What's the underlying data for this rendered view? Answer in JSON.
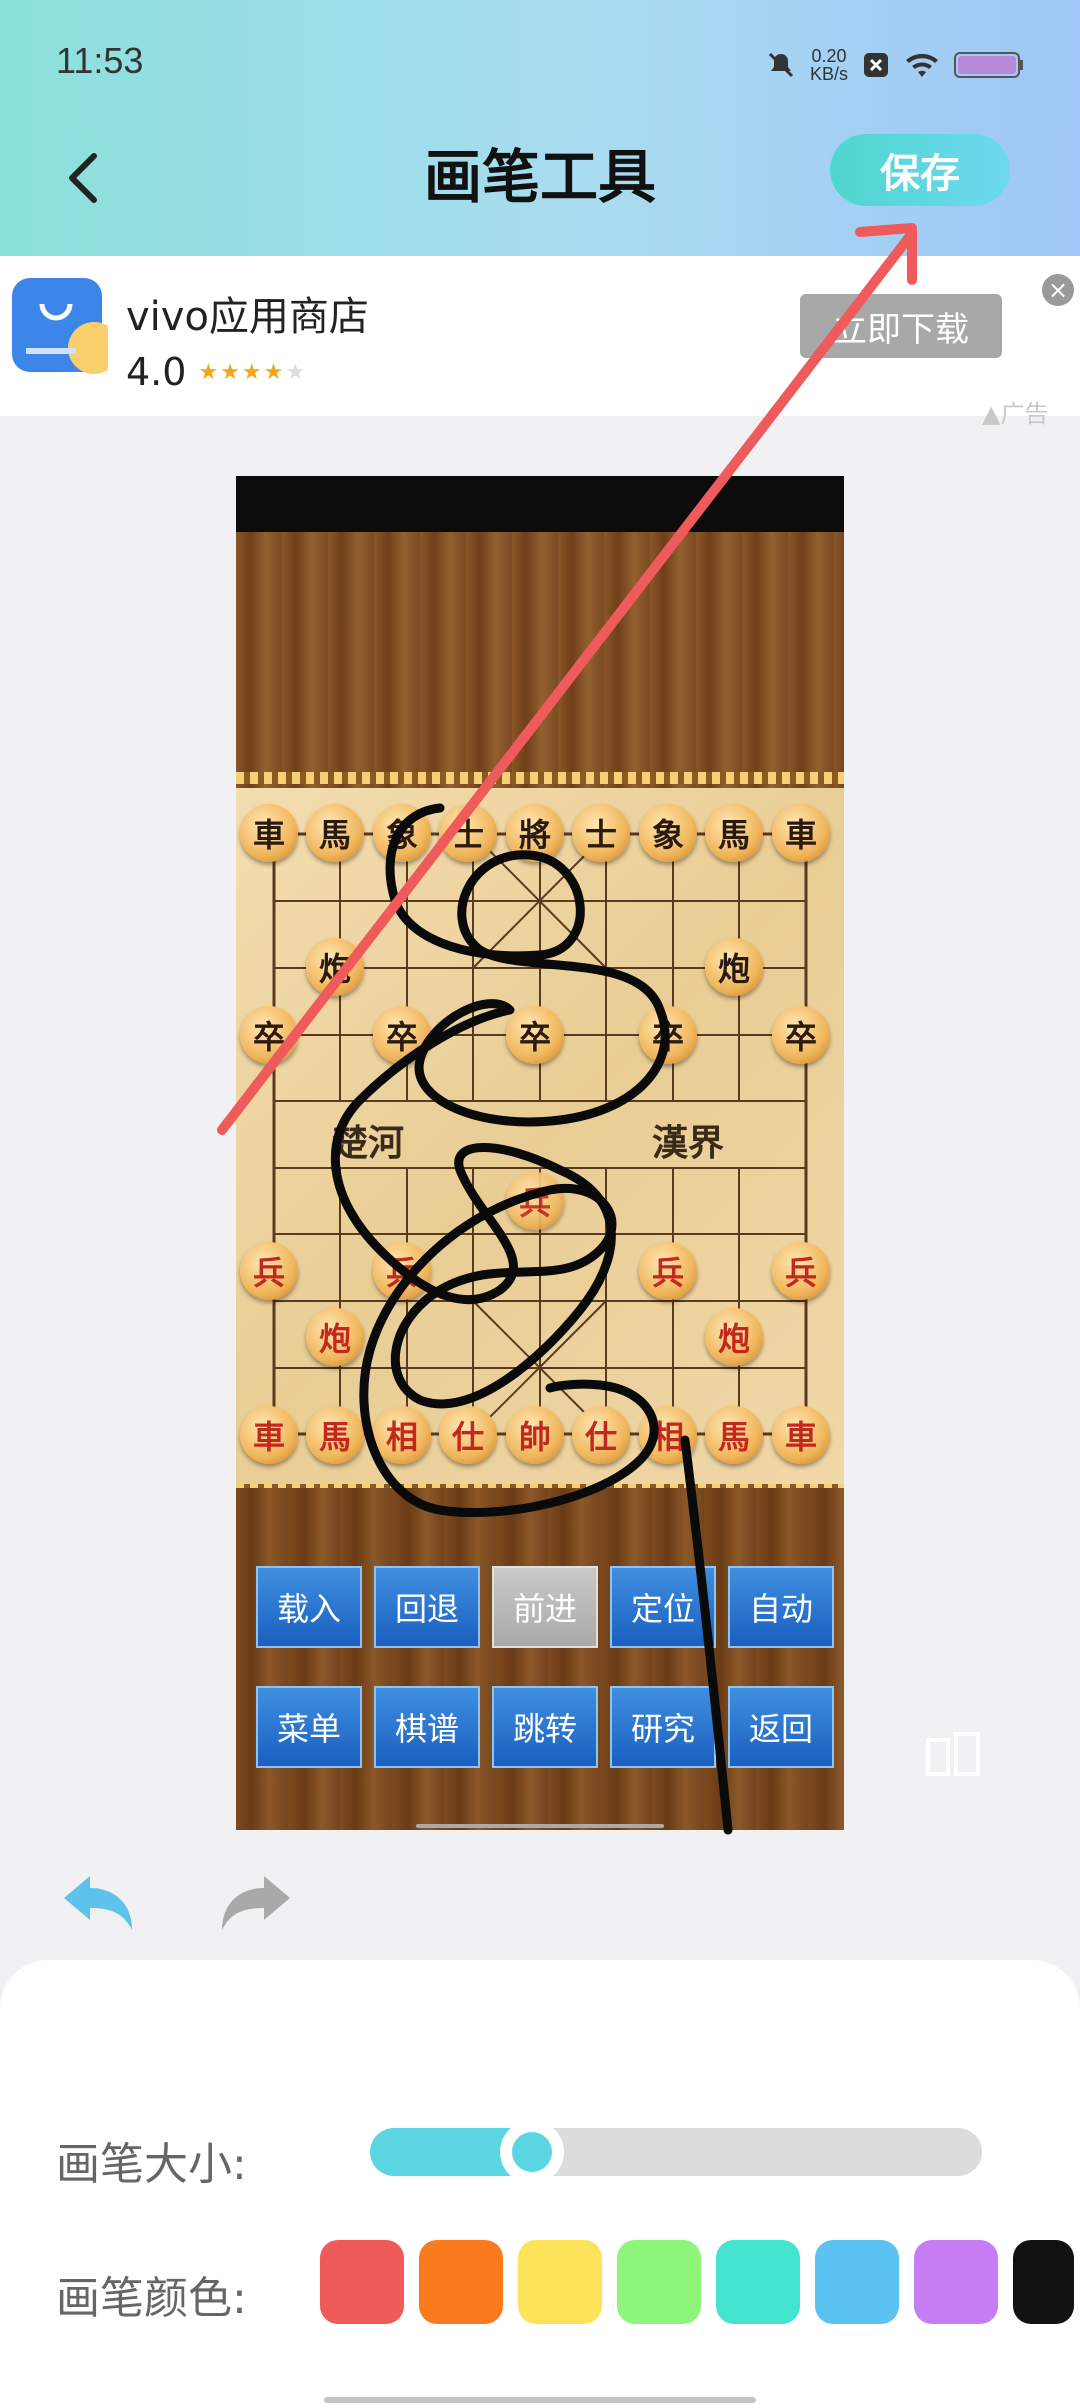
{
  "status": {
    "time": "11:53",
    "speed_value": "0.20",
    "speed_unit": "KB/s"
  },
  "header": {
    "title": "画笔工具",
    "save_label": "保存"
  },
  "ad": {
    "app_name": "vivo应用商店",
    "rating": "4.0",
    "stars": 4,
    "download_label": "立即下载",
    "close_label": "×",
    "ad_label": "广告"
  },
  "game": {
    "top_row": [
      "車",
      "馬",
      "象",
      "士",
      "將",
      "士",
      "象",
      "馬",
      "車"
    ],
    "black_cannons": [
      "炮",
      "炮"
    ],
    "black_soldiers": [
      "卒",
      "卒",
      "卒",
      "卒",
      "卒"
    ],
    "river_left": "楚河",
    "river_right": "漢界",
    "red_soldiers": [
      "兵",
      "兵",
      "兵",
      "兵",
      "兵"
    ],
    "red_cannons": [
      "炮",
      "炮"
    ],
    "bottom_row": [
      "車",
      "馬",
      "相",
      "仕",
      "帥",
      "仕",
      "相",
      "馬",
      "車"
    ],
    "buttons_row1": [
      "载入",
      "回退",
      "前进",
      "定位",
      "自动"
    ],
    "buttons_row2": [
      "菜单",
      "棋谱",
      "跳转",
      "研究",
      "返回"
    ],
    "disabled_button": "前进"
  },
  "tools": {
    "brush_size_label": "画笔大小:",
    "brush_size_fraction": 0.2,
    "brush_color_label": "画笔颜色:",
    "colors": [
      "#ef5a5a",
      "#fb7a1e",
      "#fde35a",
      "#8cf57a",
      "#44e3cf",
      "#5cc2f2",
      "#c67cf2",
      "#111111"
    ]
  }
}
